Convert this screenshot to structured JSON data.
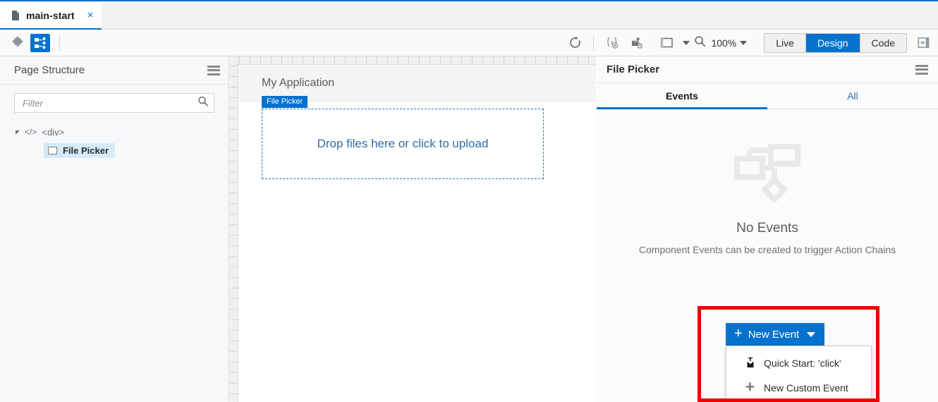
{
  "tab": {
    "label": "main-start",
    "close": "×",
    "doc_icon": "document-icon"
  },
  "toolbar": {
    "left_buttons": [
      {
        "name": "components-palette-icon",
        "label": "puzzle-icon",
        "active": false
      },
      {
        "name": "page-structure-icon",
        "label": "structure-icon",
        "active": true
      }
    ],
    "refresh_icon": "refresh-icon",
    "variables_icon": "variables-icon",
    "events_icon": "events-icon",
    "viewport_icon": "viewport-icon",
    "zoom_icon": "magnifier-icon",
    "zoom_level": "100%",
    "modes": [
      {
        "label": "Live",
        "active": false
      },
      {
        "label": "Design",
        "active": true
      },
      {
        "label": "Code",
        "active": false
      }
    ],
    "panel_toggle_icon": "panel-toggle-icon"
  },
  "left_panel": {
    "title": "Page Structure",
    "menu_icon": "hamburger-menu-icon",
    "filter": {
      "value": "",
      "placeholder": "Filter",
      "search_icon": "search-icon"
    },
    "tree": {
      "root": {
        "code_tag": "</>",
        "label": "<div>",
        "twisty": "expanded"
      },
      "child": {
        "label": "File Picker",
        "icon": "component-box-icon",
        "selected": true
      }
    }
  },
  "canvas": {
    "app_title": "My Application",
    "component_badge": "File Picker",
    "dropzone_text": "Drop files here or click to upload"
  },
  "right_panel": {
    "title": "File Picker",
    "menu_icon": "hamburger-menu-icon",
    "tabs": [
      {
        "label": "Events",
        "active": true
      },
      {
        "label": "All",
        "active": false
      }
    ],
    "empty_state": {
      "icon": "action-chain-diagram-icon",
      "title": "No Events",
      "subtitle": "Component Events can be created to trigger Action Chains"
    },
    "new_event": {
      "label": "New Event",
      "plus": "+",
      "menu_items": [
        {
          "label": "Quick Start: 'click'",
          "icon": "quick-start-icon"
        },
        {
          "label": "New Custom Event",
          "icon": "plus-icon"
        }
      ]
    }
  },
  "colors": {
    "accent": "#0572ce",
    "highlight": "#ef0000",
    "selection": "#d6eaf8"
  }
}
